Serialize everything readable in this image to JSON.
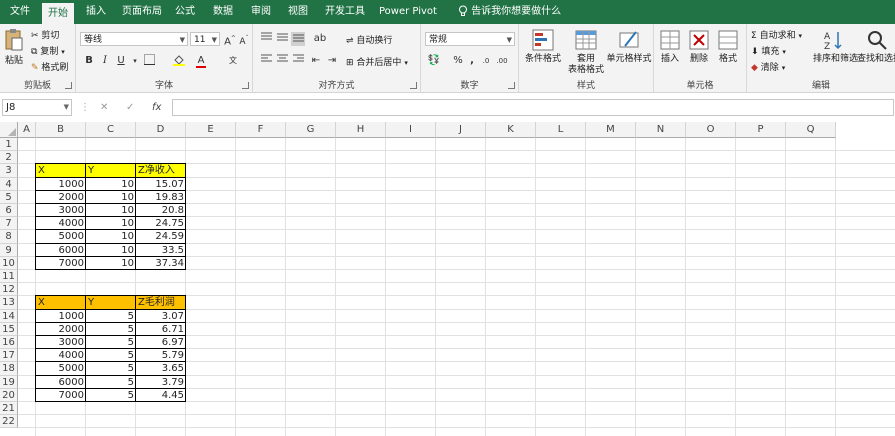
{
  "tabs": [
    "文件",
    "开始",
    "插入",
    "页面布局",
    "公式",
    "数据",
    "审阅",
    "视图",
    "开发工具",
    "Power Pivot"
  ],
  "active_tab": "开始",
  "tell_me": "告诉我你想要做什么",
  "ribbon": {
    "clipboard": {
      "paste": "粘贴",
      "cut": "剪切",
      "copy": "复制",
      "format_painter": "格式刷",
      "label": "剪贴板"
    },
    "font": {
      "name": "等线",
      "size": "11",
      "label": "字体",
      "bold": "B",
      "italic": "I",
      "underline": "U"
    },
    "alignment": {
      "wrap": "自动换行",
      "merge": "合并后居中",
      "label": "对齐方式"
    },
    "number": {
      "format": "常规",
      "label": "数字"
    },
    "styles": {
      "conditional": "条件格式",
      "table_format_1": "套用",
      "table_format_2": "表格格式",
      "cell_styles": "单元格样式",
      "label": "样式"
    },
    "cells": {
      "insert": "插入",
      "delete": "删除",
      "format": "格式",
      "label": "单元格"
    },
    "editing": {
      "autosum": "自动求和",
      "fill": "填充",
      "clear": "清除",
      "sort_filter": "排序和筛选",
      "find_select": "查找和选择",
      "label": "编辑"
    }
  },
  "formula_bar": {
    "name_box": "J8",
    "fx": "fx",
    "value": ""
  },
  "grid": {
    "columns": [
      "A",
      "B",
      "C",
      "D",
      "E",
      "F",
      "G",
      "H",
      "I",
      "J",
      "K",
      "L",
      "M",
      "N",
      "O",
      "P",
      "Q"
    ],
    "rows": [
      "1",
      "2",
      "3",
      "4",
      "5",
      "6",
      "7",
      "8",
      "9",
      "10",
      "11",
      "12",
      "13",
      "14",
      "15",
      "16",
      "17",
      "18",
      "19",
      "20",
      "21",
      "22"
    ]
  },
  "table1": {
    "headers": [
      "X",
      "Y",
      "Z净收入"
    ],
    "header_color": "#ffff00",
    "rows": [
      [
        "1000",
        "10",
        "15.07"
      ],
      [
        "2000",
        "10",
        "19.83"
      ],
      [
        "3000",
        "10",
        "20.8"
      ],
      [
        "4000",
        "10",
        "24.75"
      ],
      [
        "5000",
        "10",
        "24.59"
      ],
      [
        "6000",
        "10",
        "33.5"
      ],
      [
        "7000",
        "10",
        "37.34"
      ]
    ]
  },
  "table2": {
    "headers": [
      "X",
      "Y",
      "Z毛利润"
    ],
    "header_color": "#ffc000",
    "rows": [
      [
        "1000",
        "5",
        "3.07"
      ],
      [
        "2000",
        "5",
        "6.71"
      ],
      [
        "3000",
        "5",
        "6.97"
      ],
      [
        "4000",
        "5",
        "5.79"
      ],
      [
        "5000",
        "5",
        "3.65"
      ],
      [
        "6000",
        "5",
        "3.79"
      ],
      [
        "7000",
        "5",
        "4.45"
      ]
    ]
  },
  "colors": {
    "excel_green": "#217346",
    "ribbon_bg": "#f3f3f3"
  }
}
